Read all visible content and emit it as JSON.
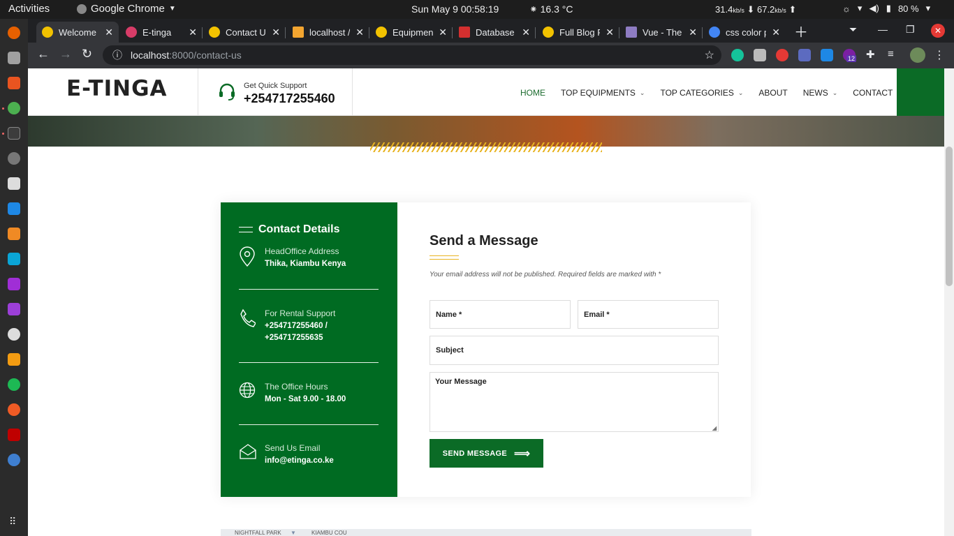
{
  "topbar": {
    "activities": "Activities",
    "app_name": "Google Chrome",
    "clock": "Sun May 9  00:58:19",
    "weather": "16.3 °C",
    "net_down": "31.4",
    "net_down_unit": "kb/s",
    "net_up": "67.2",
    "net_up_unit": "kb/s",
    "battery": "80 %"
  },
  "chrome": {
    "tabs": [
      {
        "title": "Welcome |",
        "fav": "#f2c200"
      },
      {
        "title": "E-tinga",
        "fav": "#d73c68"
      },
      {
        "title": "Contact U",
        "fav": "#f2c200"
      },
      {
        "title": "localhost /",
        "fav": "#f3a530"
      },
      {
        "title": "Equipmen",
        "fav": "#f2c200"
      },
      {
        "title": "Database",
        "fav": "#d32f2f"
      },
      {
        "title": "Full Blog F",
        "fav": "#f2c200"
      },
      {
        "title": "Vue - The",
        "fav": "#8e7cc3"
      },
      {
        "title": "css color p",
        "fav": "#4285f4"
      }
    ],
    "url_host": "localhost",
    "url_path": ":8000/contact-us",
    "ext_badge": "12"
  },
  "header": {
    "logo": "E-TINGA",
    "support_label": "Get Quick Support",
    "support_number": "+254717255460",
    "nav": [
      {
        "label": "HOME",
        "dropdown": false
      },
      {
        "label": "TOP EQUIPMENTS",
        "dropdown": true
      },
      {
        "label": "TOP CATEGORIES",
        "dropdown": true
      },
      {
        "label": "ABOUT",
        "dropdown": false
      },
      {
        "label": "NEWS",
        "dropdown": true
      },
      {
        "label": "CONTACT",
        "dropdown": false
      }
    ]
  },
  "contact": {
    "title": "Contact Details",
    "items": [
      {
        "label": "HeadOffice Address",
        "value": "Thika, Kiambu Kenya",
        "icon": "location-pin-icon"
      },
      {
        "label": "For Rental Support",
        "value": "+254717255460 / +254717255635",
        "icon": "phone-icon"
      },
      {
        "label": "The Office Hours",
        "value": "Mon - Sat 9.00 - 18.00",
        "icon": "globe-icon"
      },
      {
        "label": "Send Us Email",
        "value": "info@etinga.co.ke",
        "icon": "envelope-icon"
      }
    ]
  },
  "form": {
    "title": "Send a Message",
    "note": "Your email address will not be published. Required fields are marked with *",
    "name_label": "Name *",
    "email_label": "Email *",
    "subject_label": "Subject",
    "message_label": "Your Message",
    "submit": "SEND MESSAGE"
  },
  "map": {
    "label1": "NIGHTFALL PARK",
    "label2": "KIAMBU COU"
  }
}
